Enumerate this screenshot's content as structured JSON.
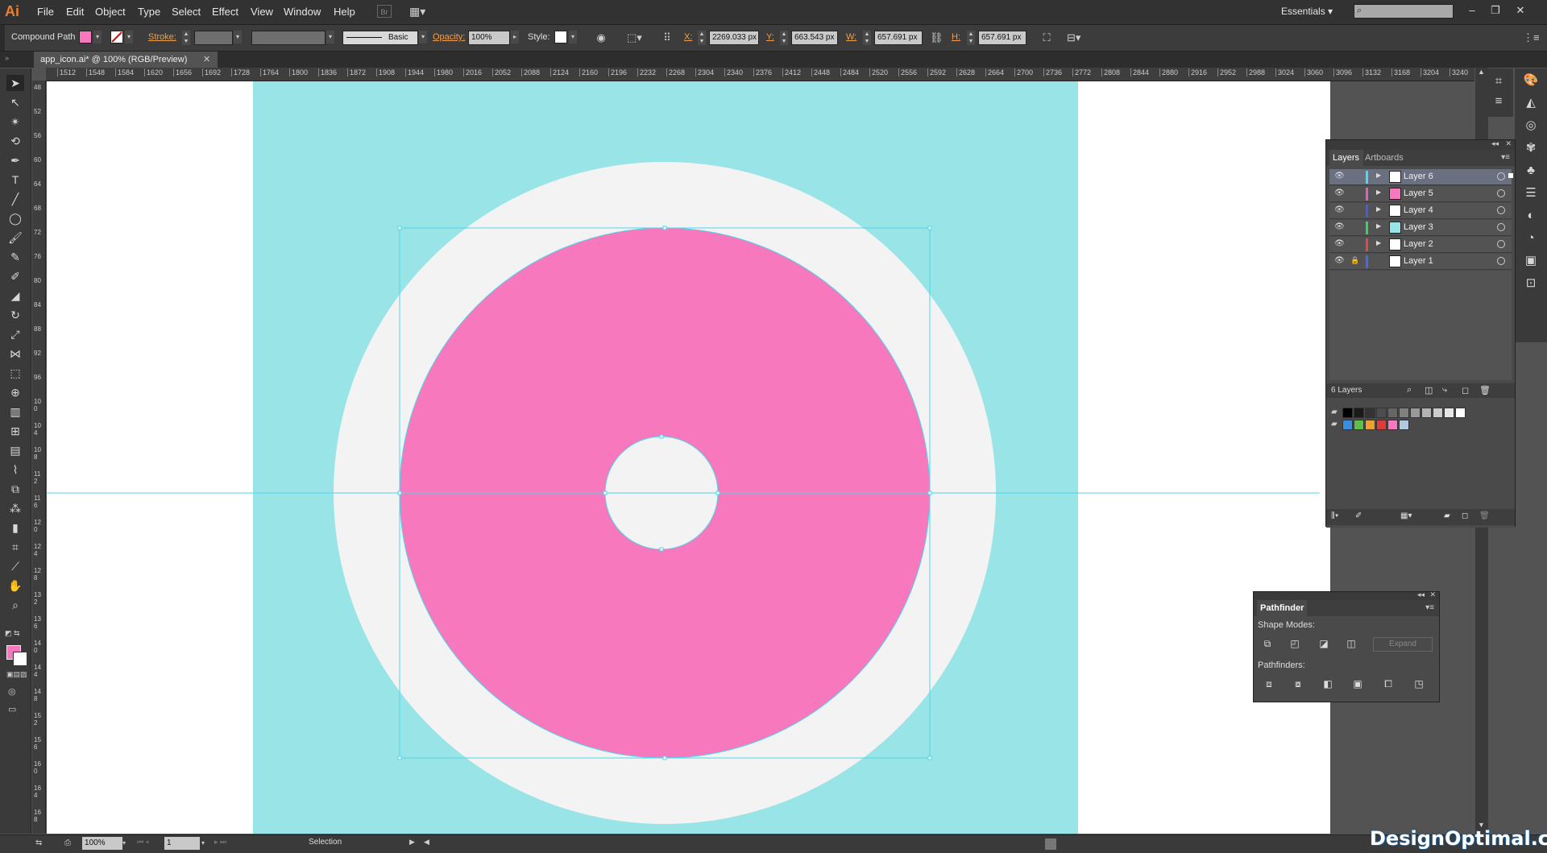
{
  "app": {
    "logo": "Ai",
    "workspace": "Essentials ▾",
    "search_placeholder": ""
  },
  "menu": [
    "File",
    "Edit",
    "Object",
    "Type",
    "Select",
    "Effect",
    "View",
    "Window",
    "Help"
  ],
  "control": {
    "selection_type": "Compound Path",
    "fill_color": "#f778bd",
    "stroke_label": "Stroke:",
    "stroke_style": "Basic",
    "opacity_label": "Opacity:",
    "opacity_value": "100%",
    "style_label": "Style:",
    "x_label": "X:",
    "x_value": "2269.033 px",
    "y_label": "Y:",
    "y_value": "663.543 px",
    "w_label": "W:",
    "w_value": "657.691 px",
    "h_label": "H:",
    "h_value": "657.691 px"
  },
  "document": {
    "tab_title": "app_icon.ai* @ 100% (RGB/Preview)"
  },
  "ruler_h": [
    "1512",
    "1548",
    "1584",
    "1620",
    "1656",
    "1692",
    "1728",
    "1764",
    "1800",
    "1836",
    "1872",
    "1908",
    "1944",
    "1980",
    "2016",
    "2052",
    "2088",
    "2124",
    "2160",
    "2196",
    "2232",
    "2268",
    "2304",
    "2340",
    "2376",
    "2412",
    "2448",
    "2484",
    "2520",
    "2556",
    "2592",
    "2628",
    "2664",
    "2700",
    "2736",
    "2772",
    "2808",
    "2844",
    "2880",
    "2916",
    "2952",
    "2988",
    "3024",
    "3060",
    "3096",
    "3132",
    "3168",
    "3204",
    "3240"
  ],
  "ruler_v": [
    "48",
    "52",
    "56",
    "60",
    "64",
    "68",
    "72",
    "76",
    "80",
    "84",
    "88",
    "92",
    "96",
    "100",
    "104",
    "108",
    "112",
    "116",
    "120",
    "124",
    "128",
    "132",
    "136",
    "140",
    "144",
    "148",
    "152",
    "156",
    "160",
    "164",
    "168",
    "172"
  ],
  "artwork": {
    "background_color": "#98e4e6",
    "outer_circle_color": "#f3f3f3",
    "donut_color": "#f778bd",
    "selection_color": "#4fd6ea"
  },
  "layers_panel": {
    "tabs": [
      "Layers",
      "Artboards"
    ],
    "layers": [
      {
        "name": "Layer 6",
        "color": "#4fd6ea",
        "selected": true
      },
      {
        "name": "Layer 5",
        "color": "#e060c0",
        "selected": false
      },
      {
        "name": "Layer 4",
        "color": "#4a5ae0",
        "selected": false
      },
      {
        "name": "Layer 3",
        "color": "#3cd06a",
        "selected": false
      },
      {
        "name": "Layer 2",
        "color": "#e04a4a",
        "selected": false
      },
      {
        "name": "Layer 1",
        "color": "#4a6ae0",
        "selected": false
      }
    ],
    "count_label": "6 Layers",
    "swatch_row1": [
      "#000000",
      "#1a1a1a",
      "#333333",
      "#4d4d4d",
      "#666666",
      "#808080",
      "#999999",
      "#b3b3b3",
      "#cccccc",
      "#e6e6e6",
      "#ffffff"
    ],
    "swatch_row2": [
      "#3a8ee0",
      "#5cc04a",
      "#f0a030",
      "#e03a3a",
      "#f778bd",
      "#b0c8e0"
    ]
  },
  "pathfinder": {
    "title": "Pathfinder",
    "shape_modes_label": "Shape Modes:",
    "pathfinders_label": "Pathfinders:",
    "expand_label": "Expand"
  },
  "status": {
    "zoom": "100%",
    "artboard": "1",
    "tool": "Selection"
  },
  "watermark": "DesignOptimal.com"
}
